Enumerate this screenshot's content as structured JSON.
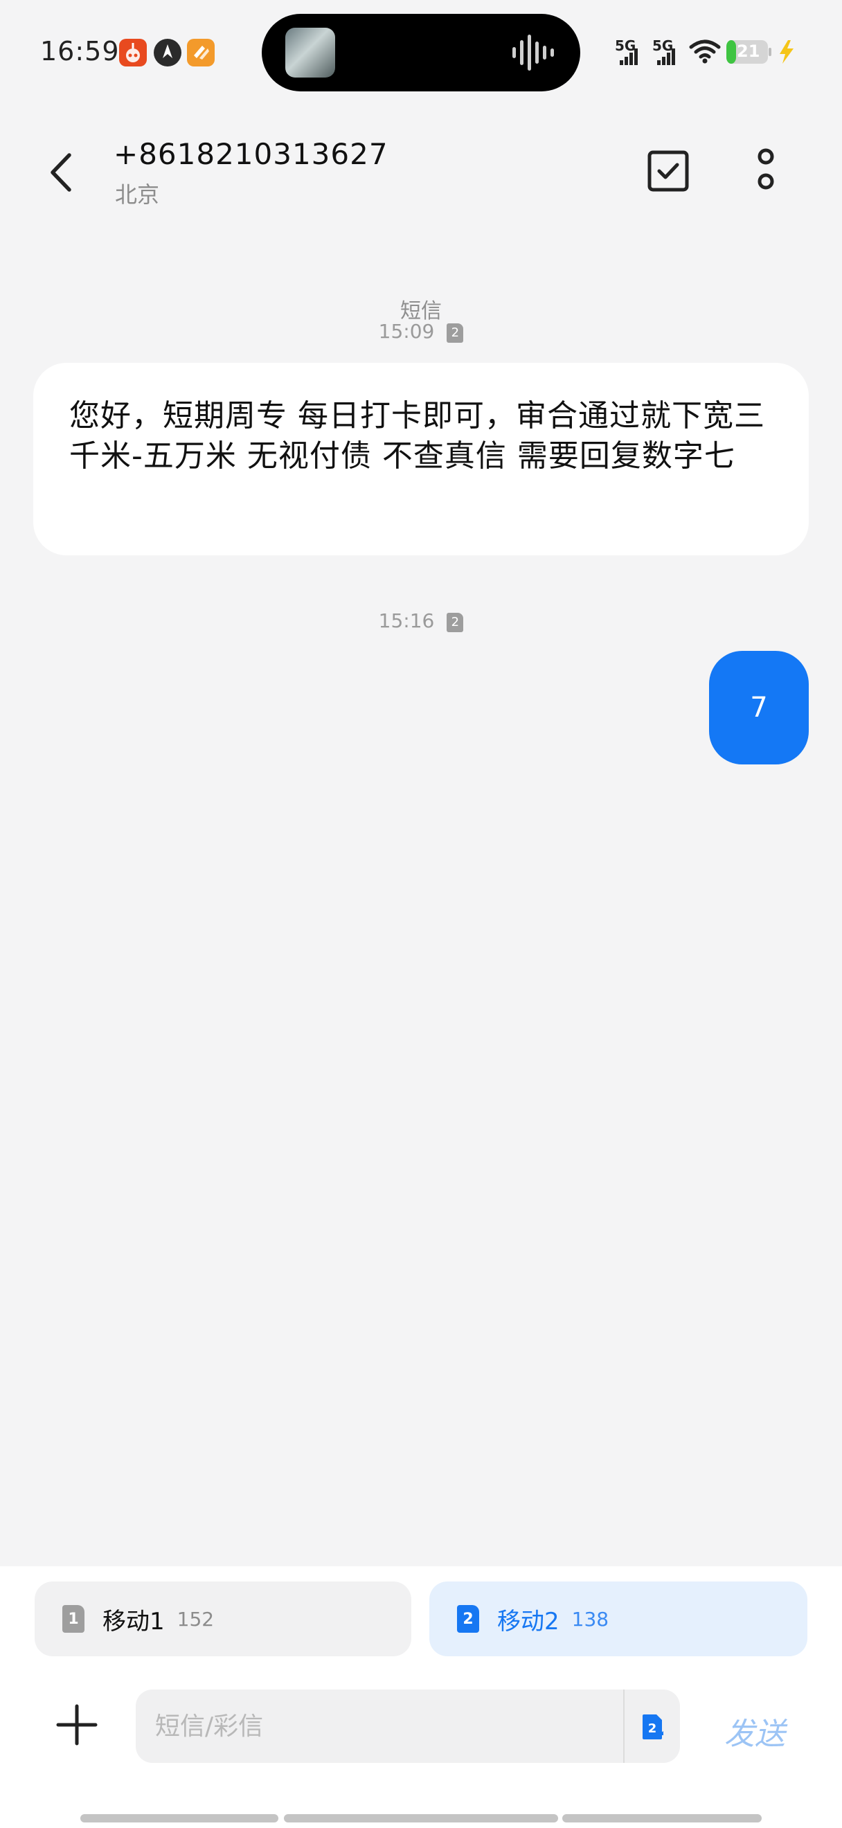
{
  "status_bar": {
    "time": "16:59",
    "network_1": "5G",
    "network_2": "5G",
    "battery_level": "21",
    "app_icons": [
      "red-robot-app-icon",
      "dark-brand-app-icon",
      "orange-app-icon"
    ]
  },
  "header": {
    "contact_number": "+8618210313627",
    "contact_location": "北京"
  },
  "messages": [
    {
      "direction": "incoming",
      "type_label": "短信",
      "time": "15:09",
      "sim": "2",
      "text": "您好，短期周专 每日打卡即可，审合通过就下宽三千米-五万米 无视付债 不查真信 需要回复数字七"
    },
    {
      "direction": "outgoing",
      "time": "15:16",
      "sim": "2",
      "text": "7"
    }
  ],
  "sim_selector": [
    {
      "badge": "1",
      "name": "移动1",
      "number": "152",
      "selected": false
    },
    {
      "badge": "2",
      "name": "移动2",
      "number": "138",
      "selected": true
    }
  ],
  "composer": {
    "placeholder": "短信/彩信",
    "sim_badge": "2",
    "send_label": "发送"
  },
  "colors": {
    "accent": "#1677f2",
    "outgoing_bubble": "#1478f5",
    "background": "#f4f4f5"
  }
}
